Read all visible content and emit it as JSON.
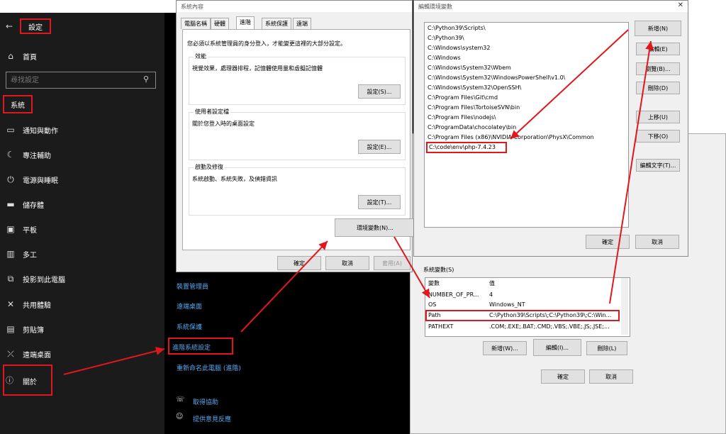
{
  "settings": {
    "header": "設定",
    "home": "首頁",
    "search_placeholder": "尋找設定",
    "section": "系統",
    "items": [
      {
        "label": "通知與動作",
        "icon": "notification-icon"
      },
      {
        "label": "專注輔助",
        "icon": "moon-icon"
      },
      {
        "label": "電源與睡眠",
        "icon": "power-icon"
      },
      {
        "label": "儲存體",
        "icon": "storage-icon"
      },
      {
        "label": "平板",
        "icon": "tablet-icon"
      },
      {
        "label": "多工",
        "icon": "multitask-icon"
      },
      {
        "label": "投影到此電腦",
        "icon": "project-icon"
      },
      {
        "label": "共用體驗",
        "icon": "share-icon"
      },
      {
        "label": "剪貼簿",
        "icon": "clipboard-icon"
      },
      {
        "label": "遠端桌面",
        "icon": "remote-icon"
      },
      {
        "label": "關於",
        "icon": "info-icon"
      }
    ],
    "links": [
      "裝置管理員",
      "遠端桌面",
      "系統保護",
      "進階系統設定",
      "重新命名此電腦 (進階)"
    ],
    "help": [
      "取得協助",
      "提供意見反應"
    ]
  },
  "sysprops": {
    "title": "系統內容",
    "tabs": [
      "電腦名稱",
      "硬體",
      "進階",
      "系統保護",
      "遠端"
    ],
    "notice": "您必須以系統管理員的身分登入，才能變更這裡的大部分設定。",
    "performance": {
      "title": "效能",
      "desc": "視覺效果，處理器排程，記憶體使用量和虛擬記憶體",
      "button": "設定(S)..."
    },
    "profile": {
      "title": "使用者設定檔",
      "desc": "關於您登入時的桌面設定",
      "button": "設定(E)..."
    },
    "startup": {
      "title": "啟動及修復",
      "desc": "系統啟動、系統失敗，及偵錯資訊",
      "button": "設定(T)..."
    },
    "env_button": "環境變數(N)...",
    "ok": "確定",
    "cancel": "取消",
    "apply": "套用(A)"
  },
  "envvars": {
    "system_title": "系統變數(S)",
    "col_var": "變數",
    "col_val": "值",
    "rows": [
      {
        "name": "NUMBER_OF_PR...",
        "value": "4"
      },
      {
        "name": "OS",
        "value": "Windows_NT"
      },
      {
        "name": "Path",
        "value": "C:\\Python39\\Scripts\\;C:\\Python39\\;C:\\Win..."
      },
      {
        "name": "PATHEXT",
        "value": ".COM;.EXE;.BAT;.CMD;.VBS;.VBE;.JS;.JSE;..."
      }
    ],
    "new": "新增(W)...",
    "edit": "編輯(I)...",
    "delete": "刪除(L)",
    "ok": "確定",
    "cancel": "取消"
  },
  "editenv": {
    "title": "編輯環境變數",
    "paths": [
      "C:\\Python39\\Scripts\\",
      "C:\\Python39\\",
      "C:\\Windows\\system32",
      "C:\\Windows",
      "C:\\Windows\\System32\\Wbem",
      "C:\\Windows\\System32\\WindowsPowerShell\\v1.0\\",
      "C:\\Windows\\System32\\OpenSSH\\",
      "C:\\Program Files\\Git\\cmd",
      "C:\\Program Files\\TortoiseSVN\\bin",
      "C:\\Program Files\\nodejs\\",
      "C:\\ProgramData\\chocolatey\\bin",
      "C:\\Program Files (x86)\\NVIDIA Corporation\\PhysX\\Common",
      "C:\\code\\env\\php-7.4.23"
    ],
    "buttons": [
      "新增(N)",
      "編輯(E)",
      "瀏覽(B)...",
      "刪除(D)",
      "上移(U)",
      "下移(O)",
      "編輯文字(T)..."
    ],
    "ok": "確定",
    "cancel": "取消"
  },
  "annotation_color": "#e0181d"
}
